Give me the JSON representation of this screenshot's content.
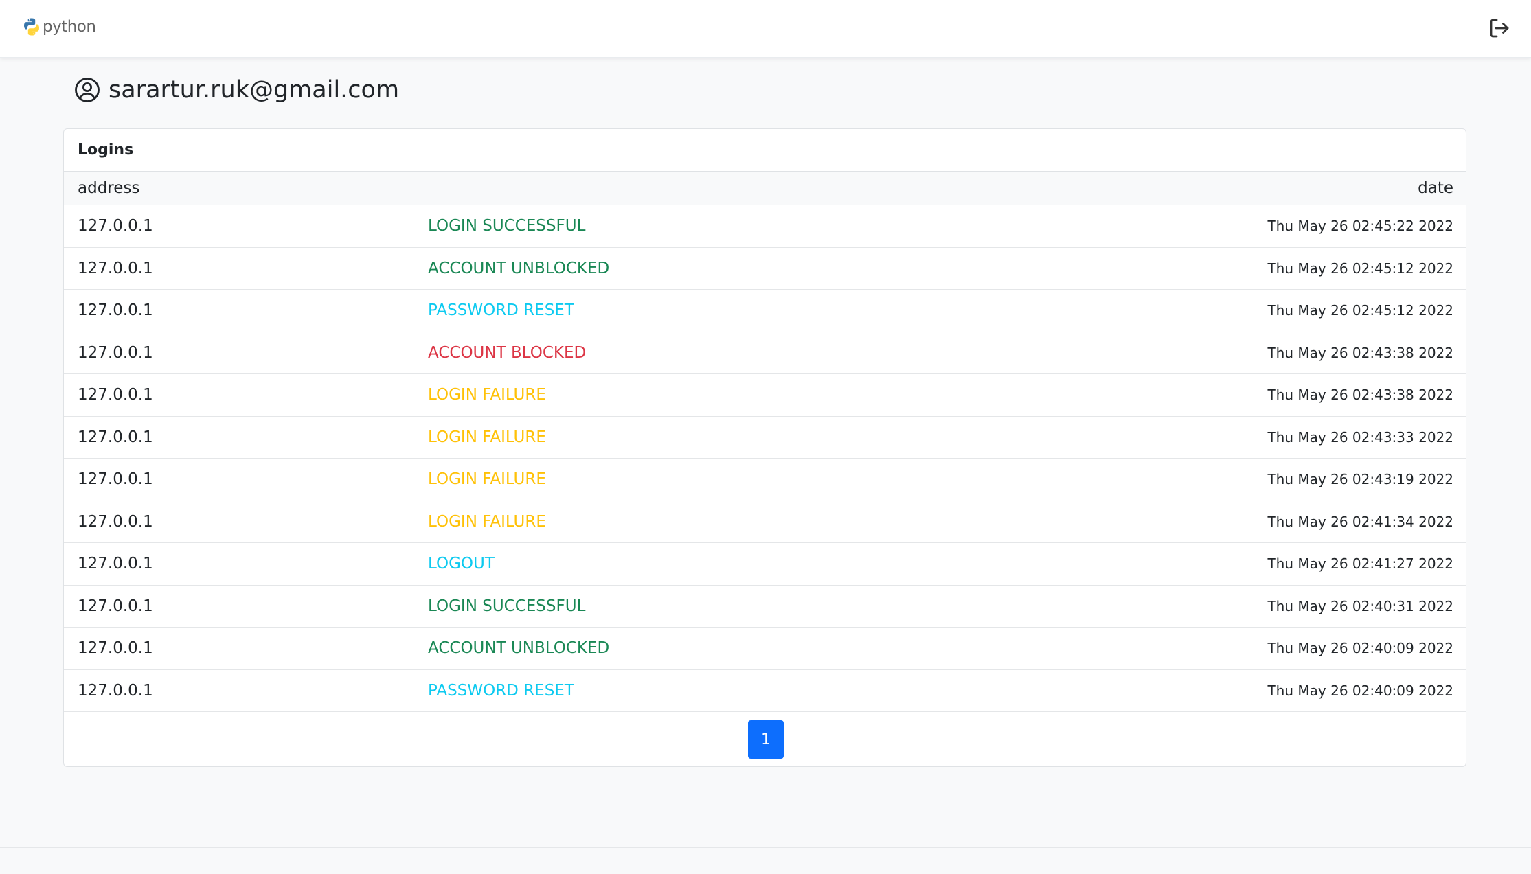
{
  "navbar": {
    "logo_text": "python",
    "logout_icon": "logout-icon"
  },
  "user": {
    "icon": "user-circle-icon",
    "email": "sarartur.ruk@gmail.com"
  },
  "card": {
    "title": "Logins",
    "columns": {
      "address": "address",
      "date": "date"
    },
    "rows": [
      {
        "address": "127.0.0.1",
        "event": "LOGIN SUCCESSFUL",
        "status": "success",
        "date": "Thu May 26 02:45:22 2022"
      },
      {
        "address": "127.0.0.1",
        "event": "ACCOUNT UNBLOCKED",
        "status": "success",
        "date": "Thu May 26 02:45:12 2022"
      },
      {
        "address": "127.0.0.1",
        "event": "PASSWORD RESET",
        "status": "info",
        "date": "Thu May 26 02:45:12 2022"
      },
      {
        "address": "127.0.0.1",
        "event": "ACCOUNT BLOCKED",
        "status": "danger",
        "date": "Thu May 26 02:43:38 2022"
      },
      {
        "address": "127.0.0.1",
        "event": "LOGIN FAILURE",
        "status": "warning",
        "date": "Thu May 26 02:43:38 2022"
      },
      {
        "address": "127.0.0.1",
        "event": "LOGIN FAILURE",
        "status": "warning",
        "date": "Thu May 26 02:43:33 2022"
      },
      {
        "address": "127.0.0.1",
        "event": "LOGIN FAILURE",
        "status": "warning",
        "date": "Thu May 26 02:43:19 2022"
      },
      {
        "address": "127.0.0.1",
        "event": "LOGIN FAILURE",
        "status": "warning",
        "date": "Thu May 26 02:41:34 2022"
      },
      {
        "address": "127.0.0.1",
        "event": "LOGOUT",
        "status": "info",
        "date": "Thu May 26 02:41:27 2022"
      },
      {
        "address": "127.0.0.1",
        "event": "LOGIN SUCCESSFUL",
        "status": "success",
        "date": "Thu May 26 02:40:31 2022"
      },
      {
        "address": "127.0.0.1",
        "event": "ACCOUNT UNBLOCKED",
        "status": "success",
        "date": "Thu May 26 02:40:09 2022"
      },
      {
        "address": "127.0.0.1",
        "event": "PASSWORD RESET",
        "status": "info",
        "date": "Thu May 26 02:40:09 2022"
      }
    ],
    "pagination": {
      "current_page": "1"
    }
  },
  "colors": {
    "success": "#198754",
    "info": "#0dcaf0",
    "danger": "#dc3545",
    "warning": "#ffc107",
    "primary": "#0d6efd"
  }
}
